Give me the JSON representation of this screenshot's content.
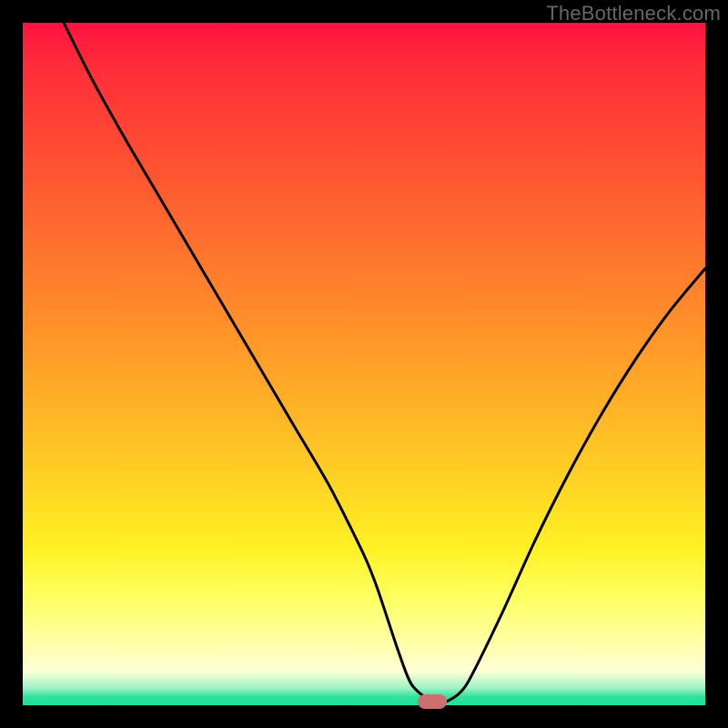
{
  "watermark": "TheBottleneck.com",
  "chart_data": {
    "type": "line",
    "title": "",
    "xlabel": "",
    "ylabel": "",
    "xlim": [
      0,
      100
    ],
    "ylim": [
      0,
      100
    ],
    "grid": false,
    "legend": false,
    "series": [
      {
        "name": "curve",
        "x": [
          6,
          10,
          15,
          20,
          25,
          30,
          35,
          40,
          45,
          50,
          52,
          55,
          57,
          60,
          62,
          65,
          70,
          75,
          80,
          85,
          90,
          95,
          100
        ],
        "y": [
          100,
          92,
          83,
          74.5,
          66,
          57.5,
          49,
          40.5,
          32,
          22,
          17,
          8,
          3,
          0.5,
          0.5,
          3,
          13,
          24,
          34,
          43,
          51,
          58,
          64
        ]
      }
    ],
    "marker": {
      "x": 60,
      "y": 0.5
    },
    "gradient_stops": [
      {
        "pos": 0,
        "color": "#ff1240"
      },
      {
        "pos": 0.42,
        "color": "#ff8a2a"
      },
      {
        "pos": 0.77,
        "color": "#fff123"
      },
      {
        "pos": 0.95,
        "color": "#feffd6"
      },
      {
        "pos": 1.0,
        "color": "#18e49c"
      }
    ]
  }
}
